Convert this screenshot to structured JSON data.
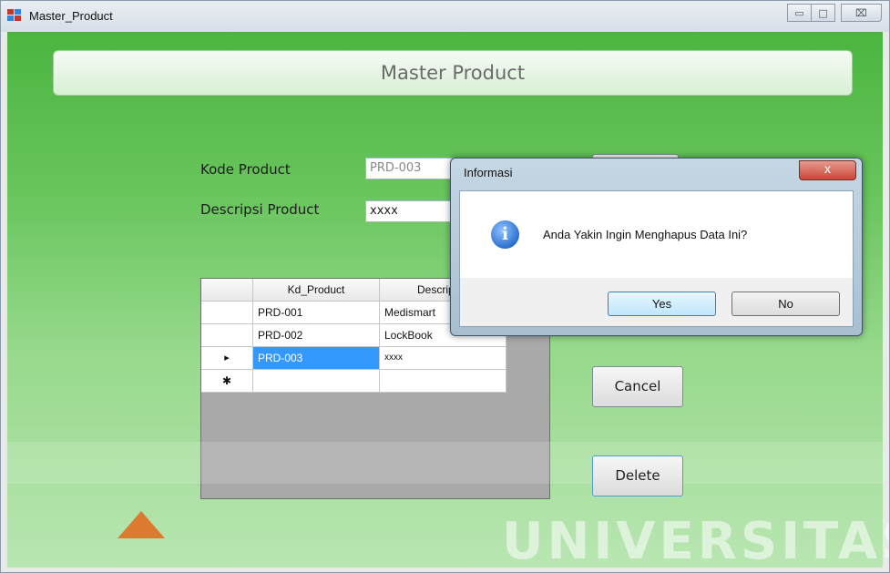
{
  "window": {
    "title": "Master_Product",
    "minimize": "▭",
    "maximize": "□",
    "close": "⌧"
  },
  "header": {
    "title": "Master Product"
  },
  "form": {
    "kode_label": "Kode Product",
    "kode_value": "PRD-003",
    "desc_label": "Descripsi Product",
    "desc_value": "xxxx"
  },
  "grid": {
    "columns": [
      "Kd_Product",
      "Descripsi_"
    ],
    "rows": [
      {
        "marker": "",
        "kd": "PRD-001",
        "desc": "Medismart"
      },
      {
        "marker": "",
        "kd": "PRD-002",
        "desc": "LockBook"
      },
      {
        "marker": "▸",
        "kd": "PRD-003",
        "desc": "xxxx"
      },
      {
        "marker": "✱",
        "kd": "",
        "desc": ""
      }
    ]
  },
  "buttons": {
    "cancel": "Cancel",
    "delete": "Delete"
  },
  "dialog": {
    "title": "Informasi",
    "close": "x",
    "message": "Anda Yakin Ingin Menghapus Data Ini?",
    "icon": "info-icon",
    "icon_glyph": "i",
    "yes": "Yes",
    "no": "No"
  },
  "watermark": "UNIVERSITAS"
}
